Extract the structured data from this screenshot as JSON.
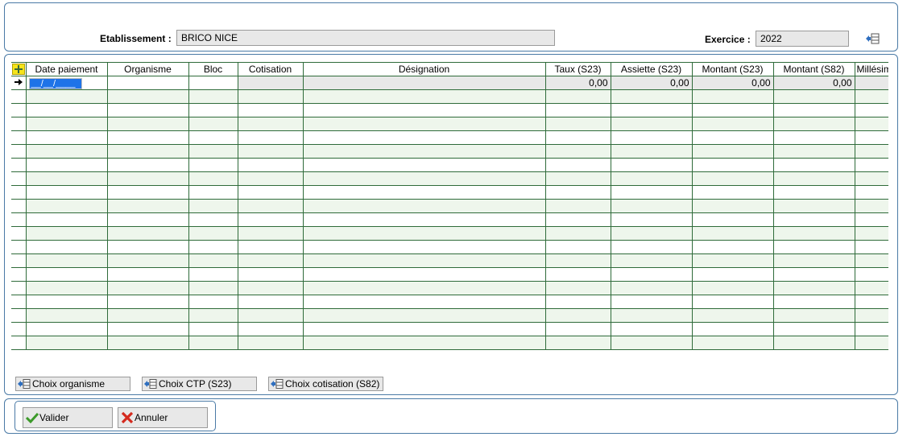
{
  "header": {
    "etablissement_label": "Etablissement :",
    "etablissement_value": "BRICO NICE",
    "exercice_label": "Exercice :",
    "exercice_value": "2022"
  },
  "grid": {
    "columns": [
      "Date paiement",
      "Organisme",
      "Bloc",
      "Cotisation",
      "Désignation",
      "Taux (S23)",
      "Assiette (S23)",
      "Montant (S23)",
      "Montant (S82)",
      "Millésime"
    ],
    "first_row": {
      "date": "__/__/____",
      "taux": "0,00",
      "assiette": "0,00",
      "montant_s23": "0,00",
      "montant_s82": "0,00"
    }
  },
  "choices": {
    "organisme": "Choix organisme",
    "ctp": "Choix CTP (S23)",
    "cotisation": "Choix cotisation (S82)"
  },
  "actions": {
    "valider": "Valider",
    "annuler": "Annuler"
  },
  "colors": {
    "panel_border": "#4a7aa6",
    "grid_line": "#2f6b3a",
    "row_alt": "#eef6ec",
    "field_bg": "#e8e8e8",
    "selection": "#1e73e8"
  }
}
